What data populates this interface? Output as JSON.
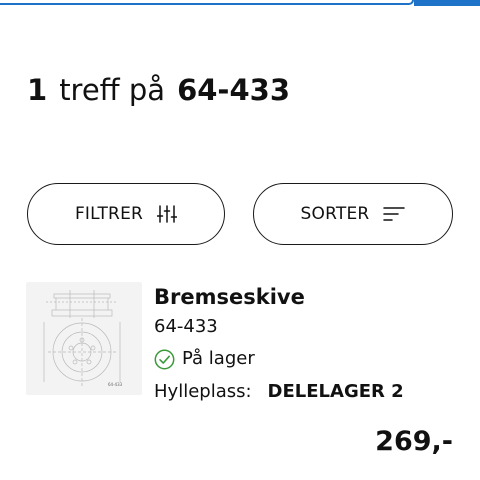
{
  "search": {
    "value": ""
  },
  "results": {
    "count": "1",
    "label": "treff på",
    "query": "64-433"
  },
  "controls": {
    "filter_label": "FILTRER",
    "filter_icon": "sliders-icon",
    "sort_label": "SORTER",
    "sort_icon": "sort-lines-icon"
  },
  "product": {
    "name": "Bremseskive",
    "sku": "64-433",
    "stock_icon": "check-circle-icon",
    "stock_label": "På lager",
    "shelf_label": "Hylleplass:",
    "shelf_value": "DELELAGER 2",
    "price": "269,-",
    "image_caption": "64-433"
  },
  "colors": {
    "accent": "#1e73c8",
    "stock_ok": "#3a9a3a",
    "text": "#111111"
  }
}
